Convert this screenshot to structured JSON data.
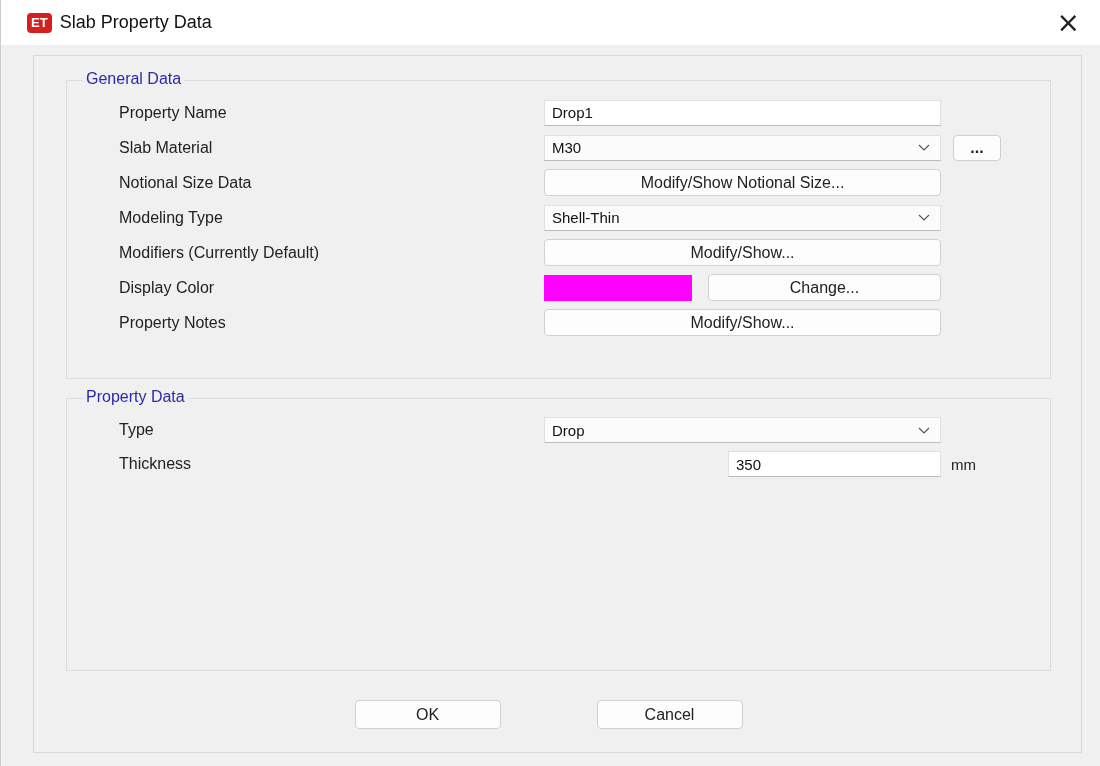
{
  "window": {
    "app_badge": "ET",
    "title": "Slab Property Data",
    "close": "×"
  },
  "general_data": {
    "title": "General Data",
    "rows": [
      {
        "label": "Property Name",
        "kind": "text",
        "value": "Drop1"
      },
      {
        "label": "Slab Material",
        "kind": "dropdown",
        "value": "M30",
        "extra_button": "..."
      },
      {
        "label": "Notional Size Data",
        "kind": "button",
        "button": "Modify/Show Notional Size..."
      },
      {
        "label": "Modeling Type",
        "kind": "dropdown",
        "value": "Shell-Thin"
      },
      {
        "label": "Modifiers (Currently Default)",
        "kind": "button",
        "button": "Modify/Show..."
      },
      {
        "label": "Display Color",
        "kind": "color",
        "color": "#ff00ff",
        "button": "Change..."
      },
      {
        "label": "Property Notes",
        "kind": "button",
        "button": "Modify/Show..."
      }
    ]
  },
  "property_data": {
    "title": "Property Data",
    "rows": [
      {
        "label": "Type",
        "kind": "dropdown",
        "value": "Drop"
      },
      {
        "label": "Thickness",
        "kind": "number",
        "value": "350",
        "unit": "mm"
      }
    ]
  },
  "buttons": [
    "OK",
    "Cancel"
  ]
}
